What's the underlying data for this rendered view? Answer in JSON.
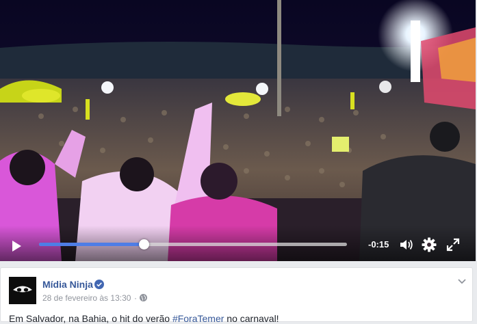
{
  "video": {
    "time_remaining": "-0:15",
    "progress": 0.34
  },
  "post": {
    "page_name": "Mídia Ninja",
    "date": "28 de fevereiro às 13:30",
    "separator": "·",
    "text_before": "Em Salvador, na Bahia, o hit do verão ",
    "hashtag": "#ForaTemer",
    "text_after": " no carnaval!"
  },
  "colors": {
    "progress_fill": "#4e7de6",
    "link": "#365899",
    "verified_badge": "#4267b2"
  },
  "icons": [
    "play-icon",
    "volume-icon",
    "gear-icon",
    "fullscreen-icon",
    "verified-icon",
    "globe-icon",
    "chevron-down-icon"
  ]
}
